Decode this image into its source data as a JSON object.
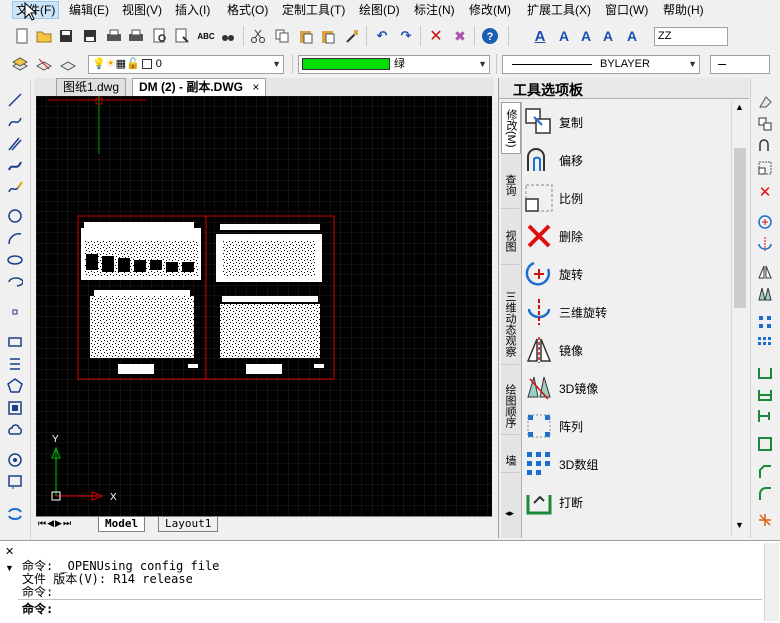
{
  "menu": [
    "文件(F)",
    "编辑(E)",
    "视图(V)",
    "插入(I)",
    "格式(O)",
    "定制工具(T)",
    "绘图(D)",
    "标注(N)",
    "修改(M)",
    "扩展工具(X)",
    "窗口(W)",
    "帮助(H)"
  ],
  "toolbar": {
    "text_style_combo": "ZZ",
    "layer_combo": "0",
    "color_combo": "绿",
    "color_swatch": "#00dd00",
    "linetype_combo": "BYLAYER"
  },
  "doc_tabs": [
    "图纸1.dwg",
    "DM (2) - 副本.DWG"
  ],
  "doc_tab_close": "×",
  "layout_tabs": [
    "Model",
    "Layout1"
  ],
  "axis": {
    "x": "X",
    "y": "Y"
  },
  "palette": {
    "title": "工具选项板",
    "tabs": [
      "修改(M)",
      "查询",
      "视图",
      "三维动态观察",
      "绘图顺序",
      "墙"
    ],
    "tools": [
      {
        "icon": "copy-icon",
        "label": "复制"
      },
      {
        "icon": "offset-icon",
        "label": "偏移"
      },
      {
        "icon": "scale-icon",
        "label": "比例"
      },
      {
        "icon": "delete-icon",
        "label": "删除"
      },
      {
        "icon": "rotate-icon",
        "label": "旋转"
      },
      {
        "icon": "rotate3d-icon",
        "label": "三维旋转"
      },
      {
        "icon": "mirror-icon",
        "label": "镜像"
      },
      {
        "icon": "mirror3d-icon",
        "label": "3D镜像"
      },
      {
        "icon": "array-icon",
        "label": "阵列"
      },
      {
        "icon": "array3d-icon",
        "label": "3D数组"
      },
      {
        "icon": "break-icon",
        "label": "打断"
      }
    ]
  },
  "command": {
    "lines": [
      "命令: _OPENUsing config file",
      "文件 版本(V): R14 release",
      "命令:"
    ],
    "prompt": "命令:"
  }
}
